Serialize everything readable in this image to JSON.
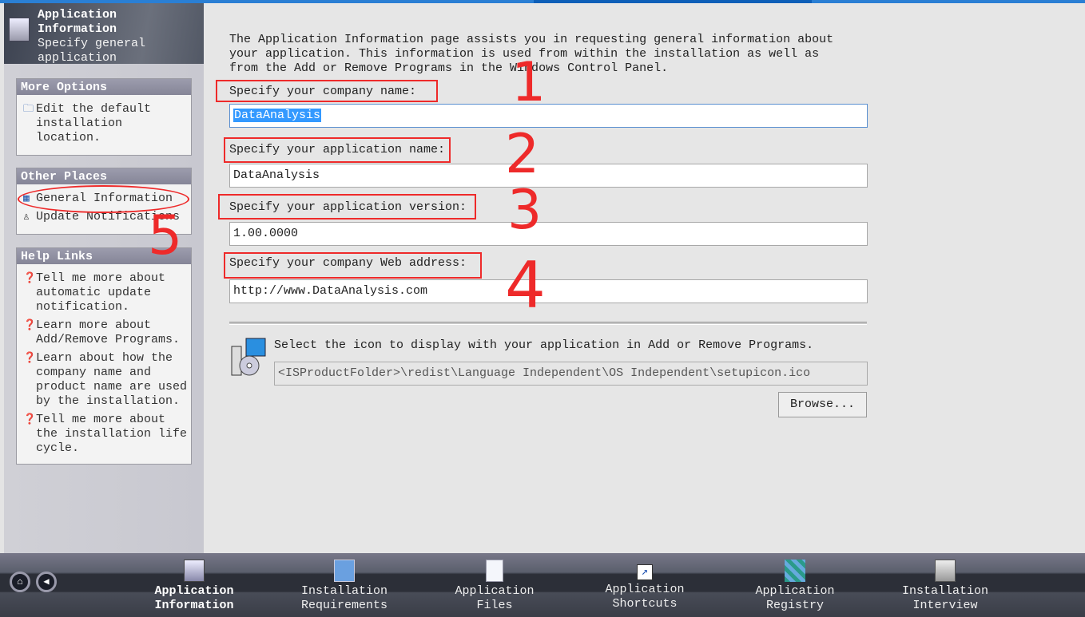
{
  "sidebar": {
    "header": {
      "title": "Application Information",
      "subtitle": "Specify general application information."
    },
    "more_options": {
      "title": "More Options",
      "items": [
        {
          "label": "Edit the default installation location.",
          "icon": "folder-icon"
        }
      ]
    },
    "other_places": {
      "title": "Other Places",
      "items": [
        {
          "label": "General Information",
          "icon": "grid-icon"
        },
        {
          "label": "Update Notifications",
          "icon": "user-globe-icon"
        }
      ]
    },
    "help_links": {
      "title": "Help Links",
      "items": [
        {
          "label": "Tell me more about automatic update notification."
        },
        {
          "label": "Learn more about Add/Remove Programs."
        },
        {
          "label": "Learn about how the company name and product name are used by the installation."
        },
        {
          "label": "Tell me more about the installation life cycle."
        }
      ]
    }
  },
  "main": {
    "intro": "The Application Information page assists you in requesting general information about\nyour application. This information is used from within the installation as well as\nfrom the Add or Remove Programs in the Windows Control Panel.",
    "company_label": "Specify your company name:",
    "company_value": "DataAnalysis",
    "appname_label": "Specify your application name:",
    "appname_value": "DataAnalysis",
    "version_label": "Specify your application version:",
    "version_value": "1.00.0000",
    "web_label": "Specify your company Web address:",
    "web_value": "http://www.DataAnalysis.com",
    "icon_label": "Select the icon to display with your application in Add or Remove Programs.",
    "icon_path": "<ISProductFolder>\\redist\\Language Independent\\OS Independent\\setupicon.ico",
    "browse_label": "Browse..."
  },
  "bottom_nav": [
    {
      "label": "Application\nInformation",
      "active": true
    },
    {
      "label": "Installation\nRequirements"
    },
    {
      "label": "Application\nFiles"
    },
    {
      "label": "Application\nShortcuts"
    },
    {
      "label": "Application\nRegistry"
    },
    {
      "label": "Installation\nInterview"
    }
  ],
  "annotations": [
    "1",
    "2",
    "3",
    "4",
    "5"
  ],
  "colors": {
    "accent": "#2a7fd4",
    "selection": "#3399ff",
    "annotation": "#ee2a2a"
  }
}
